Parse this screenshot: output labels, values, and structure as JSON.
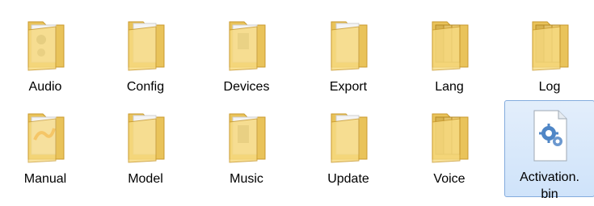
{
  "window": {
    "background": "#ffffff",
    "selection_color": "#cfe3fa",
    "selection_border": "#84acdd"
  },
  "items": [
    {
      "label": "Audio",
      "icon": "folder-audio-icon",
      "type": "folder",
      "selected": false
    },
    {
      "label": "Config",
      "icon": "folder-icon",
      "type": "folder",
      "selected": false
    },
    {
      "label": "Devices",
      "icon": "folder-devices-icon",
      "type": "folder",
      "selected": false
    },
    {
      "label": "Export",
      "icon": "folder-icon",
      "type": "folder",
      "selected": false
    },
    {
      "label": "Lang",
      "icon": "folder-stack-icon",
      "type": "folder",
      "selected": false
    },
    {
      "label": "Log",
      "icon": "folder-stack-icon",
      "type": "folder",
      "selected": false
    },
    {
      "label": "Manual",
      "icon": "folder-manual-icon",
      "type": "folder",
      "selected": false
    },
    {
      "label": "Model",
      "icon": "folder-icon",
      "type": "folder",
      "selected": false
    },
    {
      "label": "Music",
      "icon": "folder-music-icon",
      "type": "folder",
      "selected": false
    },
    {
      "label": "Update",
      "icon": "folder-icon",
      "type": "folder",
      "selected": false
    },
    {
      "label": "Voice",
      "icon": "folder-stack-icon",
      "type": "folder",
      "selected": false
    },
    {
      "label": "Activation.\nbin",
      "icon": "system-file-gear-icon",
      "type": "file",
      "selected": true
    }
  ],
  "colors": {
    "folder_back": "#e9c35a",
    "folder_front": "#f7da80",
    "folder_edge": "#c99a2e",
    "paper": "#f4f4f4",
    "accent_orange": "#f08a1c",
    "gear_blue": "#4f86c6"
  }
}
